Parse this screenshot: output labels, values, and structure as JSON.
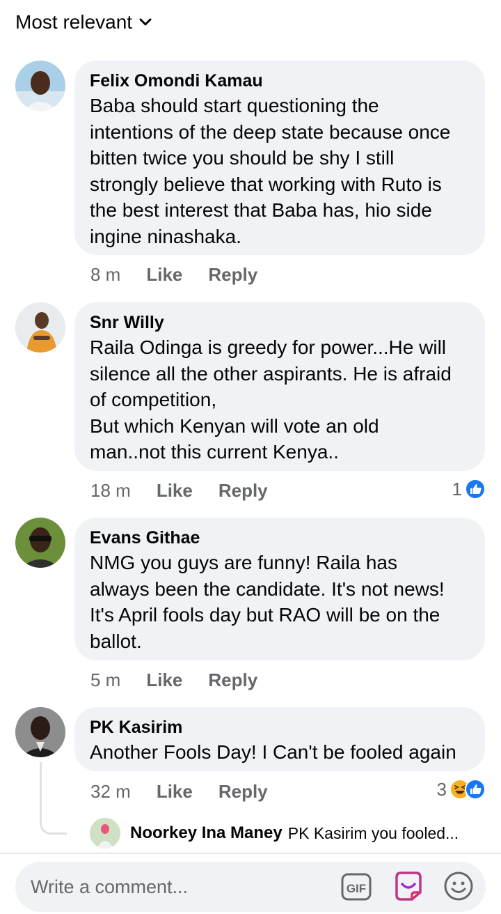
{
  "sort": {
    "label": "Most relevant"
  },
  "comments": [
    {
      "name": "Felix Omondi Kamau",
      "text": "Baba should start questioning the\nintentions of the deep state because once\nbitten twice you should be shy I still\nstrongly believe that working with Ruto is\nthe best interest that Baba has, hio side\ningine ninashaka.",
      "time": "8 m",
      "like": "Like",
      "reply": "Reply"
    },
    {
      "name": "Snr Willy",
      "text": "Raila Odinga is greedy for power...He will\nsilence all the other aspirants. He is afraid\nof competition,\nBut which Kenyan will vote an old\nman..not this current Kenya..",
      "time": "18 m",
      "like": "Like",
      "reply": "Reply",
      "reaction_count": "1"
    },
    {
      "name": "Evans Githae",
      "text": "NMG you guys are funny! Raila has\nalways been the candidate. It's not news!\nIt's April fools day but RAO will be on the\nballot.",
      "time": "5 m",
      "like": "Like",
      "reply": "Reply"
    },
    {
      "name": "PK Kasirim",
      "text": "Another Fools Day! I Can't be fooled again",
      "time": "32 m",
      "like": "Like",
      "reply": "Reply",
      "reaction_count": "3"
    }
  ],
  "reply_preview": {
    "name": "Noorkey Ina Maney",
    "text": "PK Kasirim you fooled..."
  },
  "composer": {
    "placeholder": "Write a comment...",
    "gif_label": "GIF"
  },
  "colors": {
    "bubble": "#f0f2f5",
    "like_blue": "#1877f2",
    "haha_yellow": "#f7b125",
    "meta_gray": "#65676b"
  }
}
